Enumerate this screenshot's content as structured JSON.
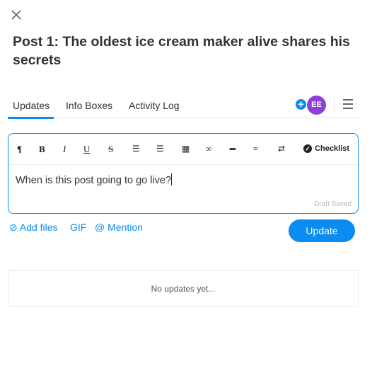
{
  "title": "Post 1: The oldest ice cream maker alive shares his secrets",
  "tabs": [
    {
      "label": "Updates",
      "active": true
    },
    {
      "label": "Info Boxes"
    },
    {
      "label": "Activity Log"
    }
  ],
  "avatar": {
    "initials": "EE",
    "color": "#8d3fd8"
  },
  "accent": "#0a8cf0",
  "toolbar": {
    "paragraph": "¶",
    "bold": "B",
    "italic": "I",
    "underline": "U",
    "strike": "S",
    "checklist": "Checklist"
  },
  "editor": {
    "value": "When is this post going to go live?",
    "status": "Draft Saved"
  },
  "actions": {
    "add_files": "Add files",
    "gif": "GIF",
    "mention": "@ Mention",
    "update": "Update"
  },
  "empty": "No updates yet..."
}
